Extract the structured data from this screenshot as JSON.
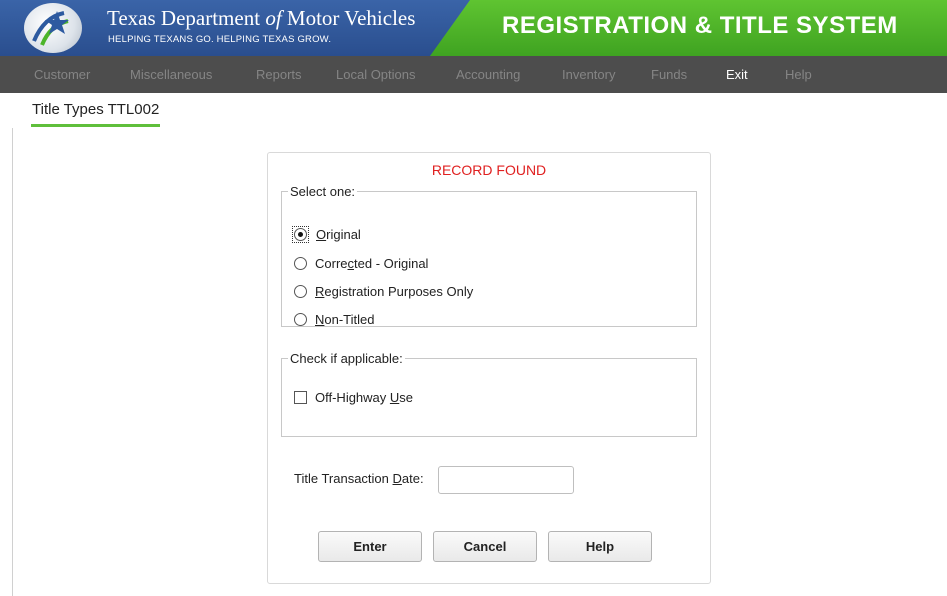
{
  "header": {
    "agency_name_part1": "Texas Department ",
    "agency_name_of": "of",
    "agency_name_part2": " Motor Vehicles",
    "tagline": "HELPING TEXANS GO. HELPING TEXAS GROW.",
    "system_title": "REGISTRATION & TITLE SYSTEM",
    "logo_icon": "txdmv-star-logo"
  },
  "menu": {
    "items": [
      {
        "label": "Customer",
        "active": false
      },
      {
        "label": "Miscellaneous",
        "active": false
      },
      {
        "label": "Reports",
        "active": false
      },
      {
        "label": "Local Options",
        "active": false
      },
      {
        "label": "Accounting",
        "active": false
      },
      {
        "label": "Inventory",
        "active": false
      },
      {
        "label": "Funds",
        "active": false
      },
      {
        "label": "Exit",
        "active": true
      },
      {
        "label": "Help",
        "active": false
      }
    ]
  },
  "page": {
    "title": "Title Types TTL002"
  },
  "dialog": {
    "status": "RECORD FOUND",
    "select_group": {
      "legend": "Select one:",
      "options": [
        {
          "pre": "",
          "mnemonic": "O",
          "post": "riginal",
          "checked": true
        },
        {
          "pre": "Corre",
          "mnemonic": "c",
          "post": "ted - Original",
          "checked": false
        },
        {
          "pre": "",
          "mnemonic": "R",
          "post": "egistration Purposes Only",
          "checked": false
        },
        {
          "pre": "",
          "mnemonic": "N",
          "post": "on-Titled",
          "checked": false
        }
      ]
    },
    "check_group": {
      "legend": "Check if applicable:",
      "option": {
        "pre": "Off-Highway ",
        "mnemonic": "U",
        "post": "se",
        "checked": false
      }
    },
    "date_field": {
      "label_pre": "Title Transaction ",
      "label_mnemonic": "D",
      "label_post": "ate:",
      "value": ""
    },
    "buttons": {
      "enter": "Enter",
      "cancel": "Cancel",
      "help": "Help"
    }
  },
  "colors": {
    "banner_blue": "#2d4f8c",
    "banner_green": "#4cb52a",
    "menu_bg": "#4d4d4d",
    "status_red": "#e02020",
    "accent_green": "#5fbf3b"
  }
}
